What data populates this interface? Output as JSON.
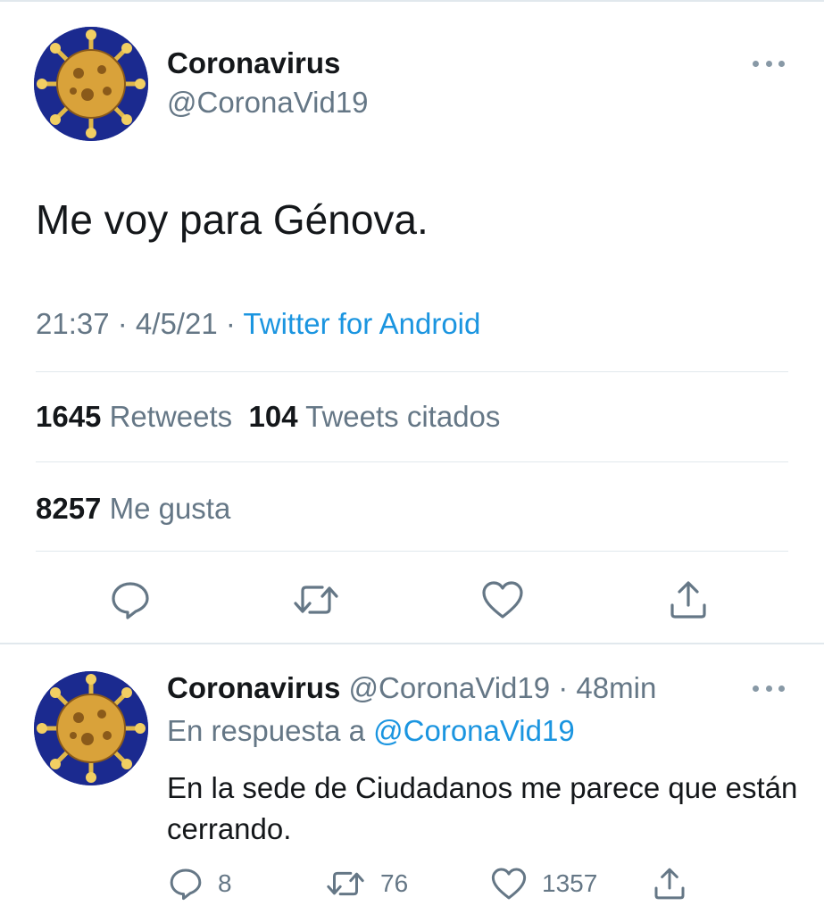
{
  "colors": {
    "text_primary": "#14171a",
    "text_secondary": "#657786",
    "link": "#1b95e0",
    "divider": "#e1e8ed",
    "icon": "#657786",
    "avatar_bg": "#1b2a8f",
    "avatar_virus": "#e0b84a"
  },
  "main_tweet": {
    "author_name": "Coronavirus",
    "handle": "@CoronaVid19",
    "text": "Me voy para Génova.",
    "time": "21:37",
    "separator": " · ",
    "date": "4/5/21",
    "source": "Twitter for Android",
    "retweets_count": "1645",
    "retweets_label": "Retweets",
    "quotes_count": "104",
    "quotes_label": "Tweets citados",
    "likes_count": "8257",
    "likes_label": "Me gusta",
    "avatar_icon": "coronavirus-avatar",
    "more_icon": "more-dots-icon",
    "actions": [
      "reply-icon",
      "retweet-icon",
      "like-icon",
      "share-icon"
    ]
  },
  "reply_tweet": {
    "author_name": "Coronavirus",
    "handle": "@CoronaVid19",
    "separator": " · ",
    "time_ago": "48min",
    "reply_to_label": "En respuesta a",
    "reply_to_mention": "@CoronaVid19",
    "text": "En la sede de Ciudadanos me parece que están cerrando.",
    "reply_count": "8",
    "retweet_count": "76",
    "like_count": "1357",
    "avatar_icon": "coronavirus-avatar",
    "more_icon": "more-dots-icon"
  }
}
